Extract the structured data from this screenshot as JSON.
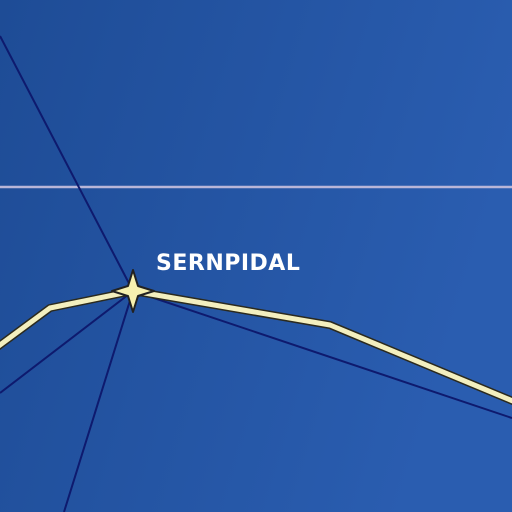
{
  "map": {
    "place_label": "SERNPIDAL",
    "colors": {
      "background_start": "#1e4c96",
      "background_end": "#2a5db0",
      "route_fill": "#f3efbf",
      "route_outline": "#2b2a1e",
      "thin_lines": "#0e1a6e",
      "horizontal_line": "#b9b6d8",
      "station_fill": "#f7f1b0",
      "station_outline": "#222222"
    },
    "icons": {
      "station": "four-point-star-icon"
    }
  }
}
